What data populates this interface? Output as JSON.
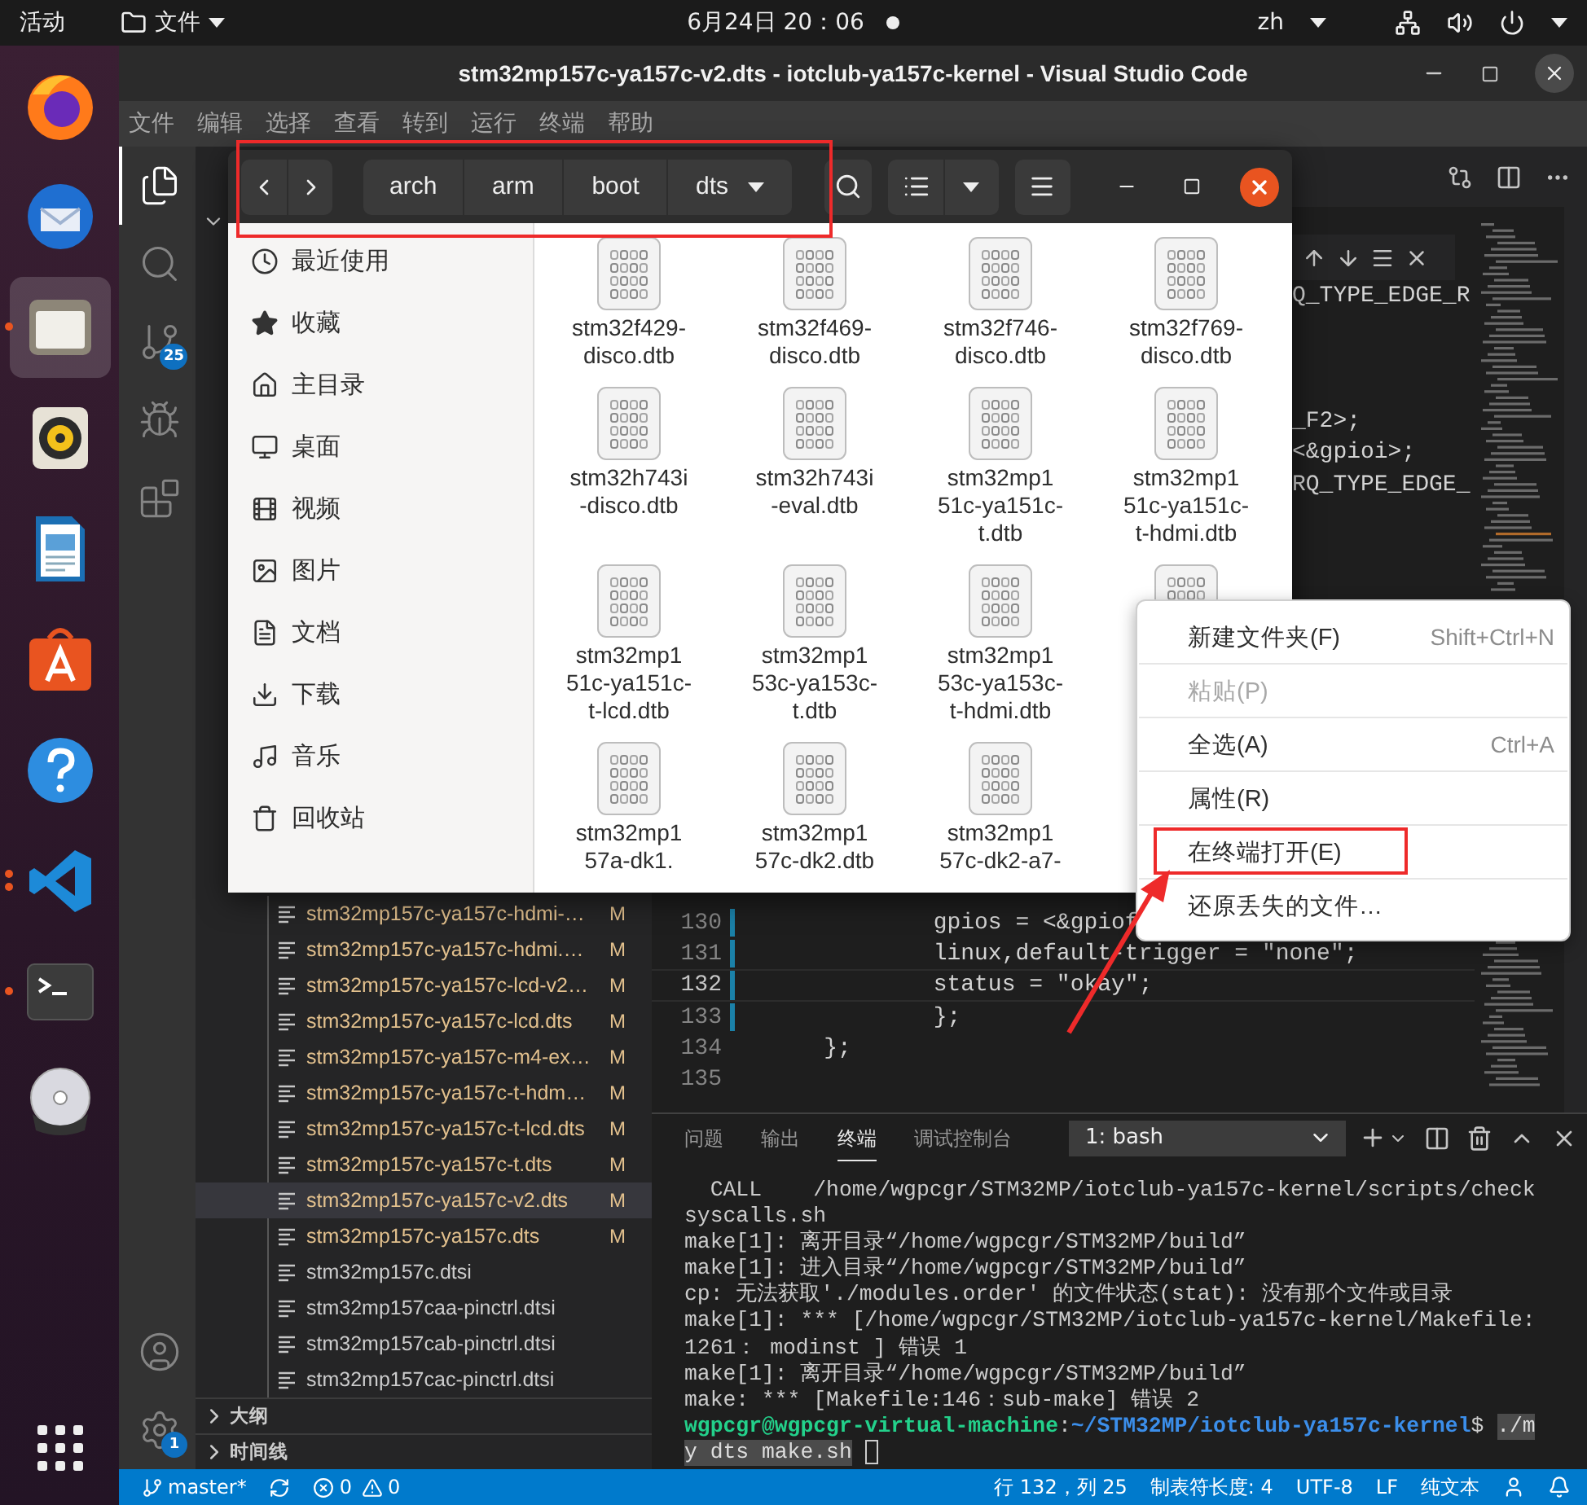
{
  "top_bar": {
    "activities": "活动",
    "app_menu": "文件",
    "clock": "6月24日 20：06",
    "input_method": "zh"
  },
  "dock": {
    "apps": [
      {
        "kind": "firefox",
        "selected": false,
        "running": false,
        "multiple_windows": false
      },
      {
        "kind": "thunderbird",
        "selected": false,
        "running": false,
        "multiple_windows": false
      },
      {
        "kind": "files",
        "selected": true,
        "running": true,
        "multiple_windows": false
      },
      {
        "kind": "rhythmbox",
        "selected": false,
        "running": false,
        "multiple_windows": false
      },
      {
        "kind": "writer",
        "selected": false,
        "running": false,
        "multiple_windows": false
      },
      {
        "kind": "software",
        "selected": false,
        "running": false,
        "multiple_windows": false
      },
      {
        "kind": "help",
        "selected": false,
        "running": false,
        "multiple_windows": false
      },
      {
        "kind": "vscode",
        "selected": false,
        "running": true,
        "multiple_windows": true
      },
      {
        "kind": "terminal",
        "selected": false,
        "running": true,
        "multiple_windows": false
      },
      {
        "kind": "dvd",
        "selected": false,
        "running": false,
        "multiple_windows": false
      }
    ],
    "bottom": [
      {
        "kind": "show-apps"
      }
    ]
  },
  "vscode": {
    "title": "stm32mp157c-ya157c-v2.dts - iotclub-ya157c-kernel - Visual Studio Code",
    "menu": [
      "文件",
      "编辑",
      "选择",
      "查看",
      "转到",
      "运行",
      "终端",
      "帮助"
    ],
    "activity": [
      {
        "kind": "explorer",
        "selected": true
      },
      {
        "kind": "search",
        "selected": false
      },
      {
        "kind": "scm",
        "selected": false,
        "badge": "25"
      },
      {
        "kind": "run",
        "selected": false
      },
      {
        "kind": "extensions",
        "selected": false
      }
    ],
    "activity_bottom": [
      {
        "kind": "account"
      },
      {
        "kind": "settings",
        "badge": "1"
      }
    ],
    "explorer": {
      "files": [
        {
          "name": "stm32mp157c-ya157c-hdmi-…",
          "status": "M",
          "selected": false
        },
        {
          "name": "stm32mp157c-ya157c-hdmi.…",
          "status": "M",
          "selected": false
        },
        {
          "name": "stm32mp157c-ya157c-lcd-v2…",
          "status": "M",
          "selected": false
        },
        {
          "name": "stm32mp157c-ya157c-lcd.dts",
          "status": "M",
          "selected": false
        },
        {
          "name": "stm32mp157c-ya157c-m4-ex…",
          "status": "M",
          "selected": false
        },
        {
          "name": "stm32mp157c-ya157c-t-hdm…",
          "status": "M",
          "selected": false
        },
        {
          "name": "stm32mp157c-ya157c-t-lcd.dts",
          "status": "M",
          "selected": false
        },
        {
          "name": "stm32mp157c-ya157c-t.dts",
          "status": "M",
          "selected": false
        },
        {
          "name": "stm32mp157c-ya157c-v2.dts",
          "status": "M",
          "selected": true
        },
        {
          "name": "stm32mp157c-ya157c.dts",
          "status": "M",
          "selected": false
        },
        {
          "name": "stm32mp157c.dtsi",
          "selected": false
        },
        {
          "name": "stm32mp157caa-pinctrl.dtsi",
          "selected": false
        },
        {
          "name": "stm32mp157cab-pinctrl.dtsi",
          "selected": false
        },
        {
          "name": "stm32mp157cac-pinctrl.dtsi",
          "selected": false
        }
      ],
      "sections": [
        {
          "title": "大纲",
          "expanded": false
        },
        {
          "title": "时间线",
          "expanded": false
        }
      ]
    },
    "editor": {
      "fragments": [
        "Q_TYPE_EDGE_R",
        "_F2>;",
        "<&gpioi>;",
        "RQ_TYPE_EDGE_"
      ],
      "lines": [
        {
          "number": "130",
          "code": "            gpios = <&gpiof",
          "current": false,
          "modified": true
        },
        {
          "number": "131",
          "code": "            linux,default-trigger = \"none\";",
          "current": false,
          "modified": true
        },
        {
          "number": "132",
          "code": "            status = \"okay\";",
          "current": true,
          "modified": true
        },
        {
          "number": "133",
          "code": "            };",
          "current": false,
          "modified": true
        },
        {
          "number": "134",
          "code": "    };",
          "current": false,
          "modified": false
        },
        {
          "number": "135",
          "current": false,
          "modified": false
        }
      ]
    },
    "panel": {
      "tabs": [
        {
          "label": "问题",
          "selected": false
        },
        {
          "label": "输出",
          "selected": false
        },
        {
          "label": "终端",
          "selected": true
        },
        {
          "label": "调试控制台",
          "selected": false
        }
      ],
      "terminal_select": "1: bash",
      "output": [
        "  CALL    /home/wgpcgr/STM32MP/iotclub-ya157c-kernel/scripts/check",
        "syscalls.sh",
        "make[1]: 离开目录“/home/wgpcgr/STM32MP/build”",
        "make[1]: 进入目录“/home/wgpcgr/STM32MP/build”",
        "cp: 无法获取'./modules.order' 的文件状态(stat): 没有那个文件或目录",
        "make[1]: *** [/home/wgpcgr/STM32MP/iotclub-ya157c-kernel/Makefile:",
        "1261： modinst ] 错误 1",
        "make[1]: 离开目录“/home/wgpcgr/STM32MP/build”",
        "make: *** [Makefile:146：sub-make] 错误 2"
      ],
      "prompt": {
        "user_host": "wgpcgr@wgpcgr-virtual-machine",
        "separator": ":",
        "path": "~/STM32MP/iotclub-ya157c-kernel",
        "symbol": "$",
        "command": [
          "./m",
          "y dts make.sh"
        ]
      }
    },
    "status_bar": {
      "branch": "master*",
      "errors": "0",
      "warnings": "0",
      "position": "行 132，列 25",
      "tab_size": "制表符长度: 4",
      "encoding": "UTF-8",
      "eol": "LF",
      "language": "纯文本"
    }
  },
  "file_manager": {
    "path": [
      "arch",
      "arm",
      "boot",
      "dts"
    ],
    "path_framed": true,
    "places": [
      {
        "kind": "recent",
        "label": "最近使用"
      },
      {
        "kind": "starred",
        "label": "收藏"
      },
      {
        "kind": "home",
        "label": "主目录"
      },
      {
        "kind": "desktop",
        "label": "桌面"
      },
      {
        "kind": "videos",
        "label": "视频"
      },
      {
        "kind": "pictures",
        "label": "图片"
      },
      {
        "kind": "documents",
        "label": "文档"
      },
      {
        "kind": "downloads",
        "label": "下载"
      },
      {
        "kind": "music",
        "label": "音乐"
      },
      {
        "kind": "trash",
        "label": "回收站"
      }
    ],
    "files": [
      {
        "kind": "file",
        "name": "stm32f429-\ndisco.dtb"
      },
      {
        "kind": "file",
        "name": "stm32f469-\ndisco.dtb"
      },
      {
        "kind": "file",
        "name": "stm32f746-\ndisco.dtb"
      },
      {
        "kind": "file",
        "name": "stm32f769-\ndisco.dtb"
      },
      {
        "kind": "file",
        "name": "stm32h743i\n-disco.dtb"
      },
      {
        "kind": "file",
        "name": "stm32h743i\n-eval.dtb"
      },
      {
        "kind": "file",
        "name": "stm32mp1\n51c-ya151c-\nt.dtb"
      },
      {
        "kind": "file",
        "name": "stm32mp1\n51c-ya151c-\nt-hdmi.dtb"
      },
      {
        "kind": "file",
        "name": "stm32mp1\n51c-ya151c-\nt-lcd.dtb"
      },
      {
        "kind": "file",
        "name": "stm32mp1\n53c-ya153c-\nt.dtb"
      },
      {
        "kind": "file",
        "name": "stm32mp1\n53c-ya153c-\nt-hdmi.dtb"
      },
      {
        "kind": "icon-only"
      },
      {
        "kind": "file",
        "name": "stm32mp1\n57a-dk1."
      },
      {
        "kind": "file",
        "name": "stm32mp1\n57c-dk2.dtb"
      },
      {
        "kind": "file",
        "name": "stm32mp1\n57c-dk2-a7-"
      }
    ]
  },
  "context_menu": {
    "items": [
      {
        "label": "新建文件夹(F)",
        "shortcut": "Shift+Ctrl+N",
        "disabled": false,
        "framed": false
      },
      {
        "label": "粘贴(P)",
        "disabled": true,
        "framed": false
      },
      {
        "label": "全选(A)",
        "shortcut": "Ctrl+A",
        "disabled": false,
        "framed": false
      },
      {
        "label": "属性(R)",
        "disabled": false,
        "framed": false
      },
      {
        "label": "在终端打开(E)",
        "disabled": false,
        "framed": true
      },
      {
        "label": "还原丢失的文件…",
        "disabled": false,
        "framed": false
      }
    ]
  }
}
